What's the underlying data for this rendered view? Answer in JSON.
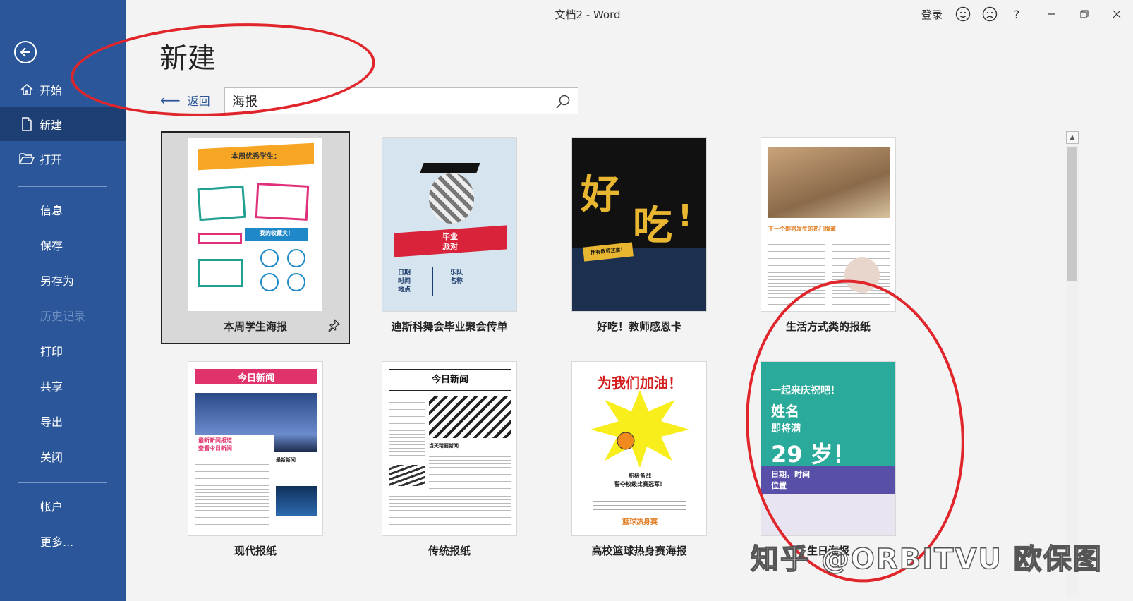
{
  "window": {
    "title": "文档2  -  Word",
    "login": "登录"
  },
  "sidebar": {
    "items": [
      {
        "label": "开始"
      },
      {
        "label": "新建"
      },
      {
        "label": "打开"
      },
      {
        "label": "信息"
      },
      {
        "label": "保存"
      },
      {
        "label": "另存为"
      },
      {
        "label": "历史记录"
      },
      {
        "label": "打印"
      },
      {
        "label": "共享"
      },
      {
        "label": "导出"
      },
      {
        "label": "关闭"
      },
      {
        "label": "帐户"
      },
      {
        "label": "更多..."
      }
    ]
  },
  "main": {
    "title": "新建",
    "back_label": "返回",
    "search_value": "海报"
  },
  "templates": [
    {
      "label": "本周学生海报",
      "thumb_text": [
        "本周优秀学生：",
        "我的收藏夹！"
      ]
    },
    {
      "label": "迪斯科舞会毕业聚会传单",
      "thumb_text": [
        "毕业",
        "派对",
        "日期",
        "时间",
        "地点",
        "乐队",
        "名称"
      ]
    },
    {
      "label": "好吃！教师感恩卡",
      "thumb_text": [
        "好",
        "吃",
        "!",
        "所有教师注意！"
      ]
    },
    {
      "label": "生活方式类的报纸",
      "thumb_text": [
        "下一个即将发生的热门报道"
      ]
    },
    {
      "label": "现代报纸",
      "thumb_text": [
        "今日新闻",
        "最新新闻报道",
        "查看今日新闻",
        "最新新闻"
      ]
    },
    {
      "label": "传统报纸",
      "thumb_text": [
        "今日新闻",
        "当天精要新闻"
      ]
    },
    {
      "label": "高校篮球热身赛海报",
      "thumb_text": [
        "为我们加油！",
        "积极备战",
        "誓夺校级比赛冠军！",
        "篮球热身赛"
      ]
    },
    {
      "label": "生日海报",
      "thumb_text": [
        "一起来庆祝吧！",
        "姓名",
        "即将满",
        "29 岁！",
        "日期，时间",
        "位置"
      ]
    }
  ],
  "watermark": "知乎 @ORBITVU 欧保图",
  "colors": {
    "sidebar": "#2b579a",
    "sidebar_active": "#1e3f73",
    "annotation": "#e0252b"
  }
}
